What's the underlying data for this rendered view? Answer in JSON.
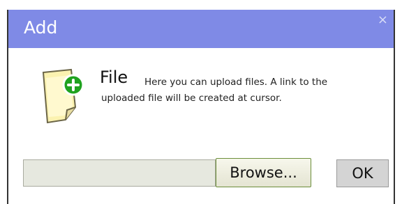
{
  "dialog": {
    "title": "Add",
    "close_glyph": "×"
  },
  "content": {
    "icon": "file-add-icon",
    "heading": "File",
    "description_line1": "Here you can upload files. A link to the",
    "description_line2": "uploaded file will be created at cursor."
  },
  "form": {
    "file_value": "",
    "browse_label": "Browse...",
    "ok_label": "OK"
  },
  "colors": {
    "titlebar": "#7f8ae6",
    "add_badge": "#1fa21f",
    "note": "#fbf2b0"
  }
}
